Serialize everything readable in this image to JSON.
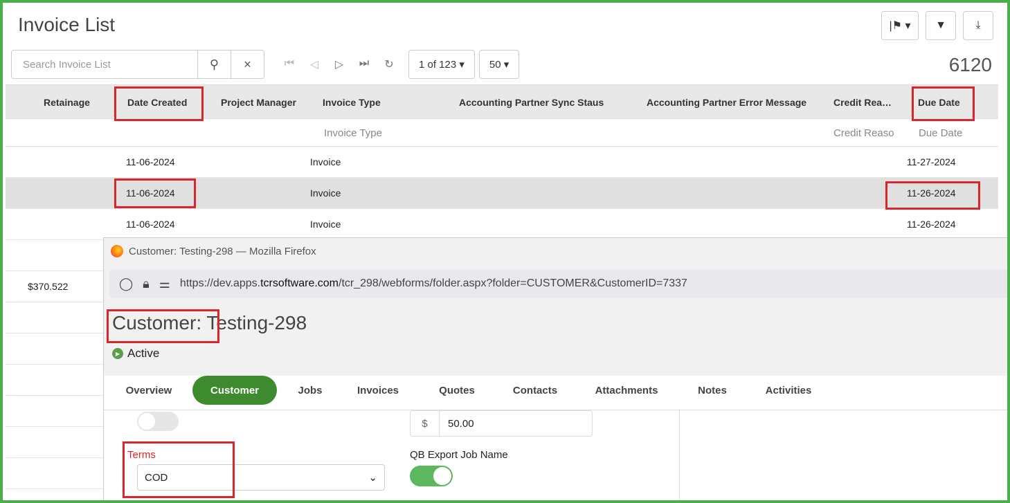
{
  "page": {
    "title": "Invoice List",
    "total": "6120"
  },
  "header_buttons": [
    {
      "icon": "flag-icon",
      "glyph": "|⚑ ▾"
    },
    {
      "icon": "filter-icon",
      "glyph": "▼"
    },
    {
      "icon": "download-icon",
      "glyph": "⤓"
    }
  ],
  "toolbar": {
    "search_placeholder": "Search Invoice List",
    "search_icon": "⚲",
    "clear_icon": "×",
    "pager_first": "⏮",
    "pager_prev": "◁",
    "pager_next": "▷",
    "pager_last": "⏭",
    "refresh": "↻",
    "page_select": "1 of 123 ▾",
    "page_size": "50 ▾"
  },
  "grid": {
    "columns": {
      "retainage": "Retainage",
      "date_created": "Date Created",
      "project_manager": "Project Manager",
      "invoice_type": "Invoice Type",
      "sync_status": "Accounting Partner Sync Staus",
      "error_message": "Accounting Partner Error Message",
      "credit_reason": "Credit Rea…",
      "due_date": "Due Date"
    },
    "filters": {
      "invoice_type": "Invoice Type",
      "credit_reason": "Credit Reaso",
      "due_date": "Due Date"
    },
    "rows": [
      {
        "date_created": "11-06-2024",
        "invoice_type": "Invoice",
        "due_date": "11-27-2024"
      },
      {
        "date_created": "11-06-2024",
        "invoice_type": "Invoice",
        "due_date": "11-26-2024"
      },
      {
        "date_created": "11-06-2024",
        "invoice_type": "Invoice",
        "due_date": "11-26-2024"
      }
    ],
    "partial_retainage": "$370.522"
  },
  "popup": {
    "window_title": "Customer: Testing-298 — Mozilla Firefox",
    "url_prefix": "https://dev.apps.",
    "url_host": "tcrsoftware.com",
    "url_suffix": "/tcr_298/webforms/folder.aspx?folder=CUSTOMER&CustomerID=7337",
    "customer_label": "Customer:",
    "customer_name": " Testing-298",
    "status": "Active",
    "tabs": [
      "Overview",
      "Customer",
      "Jobs",
      "Invoices",
      "Quotes",
      "Contacts",
      "Attachments",
      "Notes",
      "Activities"
    ],
    "active_tab": "Customer",
    "currency_symbol": "$",
    "amount": "50.00",
    "terms_label": "Terms",
    "terms_value": "COD",
    "qb_label": "QB Export Job Name"
  },
  "colors": {
    "frame": "#4cae4c",
    "highlight": "#d9262c",
    "active_tab": "#3e8a2e"
  }
}
